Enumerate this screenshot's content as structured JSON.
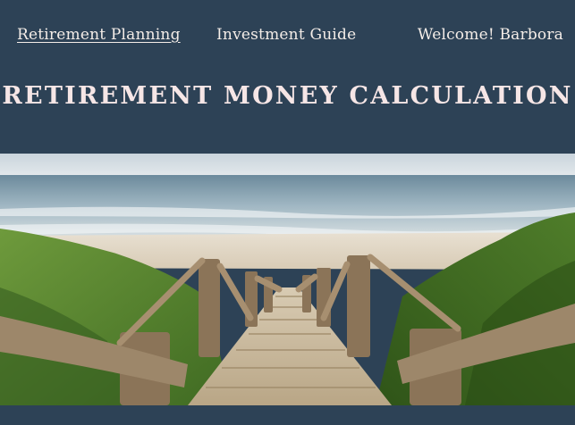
{
  "nav": {
    "retirement_planning": "Retirement Planning",
    "investment_guide": "Investment Guide",
    "welcome": "Welcome! Barbora"
  },
  "page": {
    "title": "RETIREMENT MONEY CALCULATION"
  },
  "colors": {
    "header_bg": "#2d4256",
    "nav_text": "#f4ede8",
    "title_text": "#f6e6e6"
  }
}
